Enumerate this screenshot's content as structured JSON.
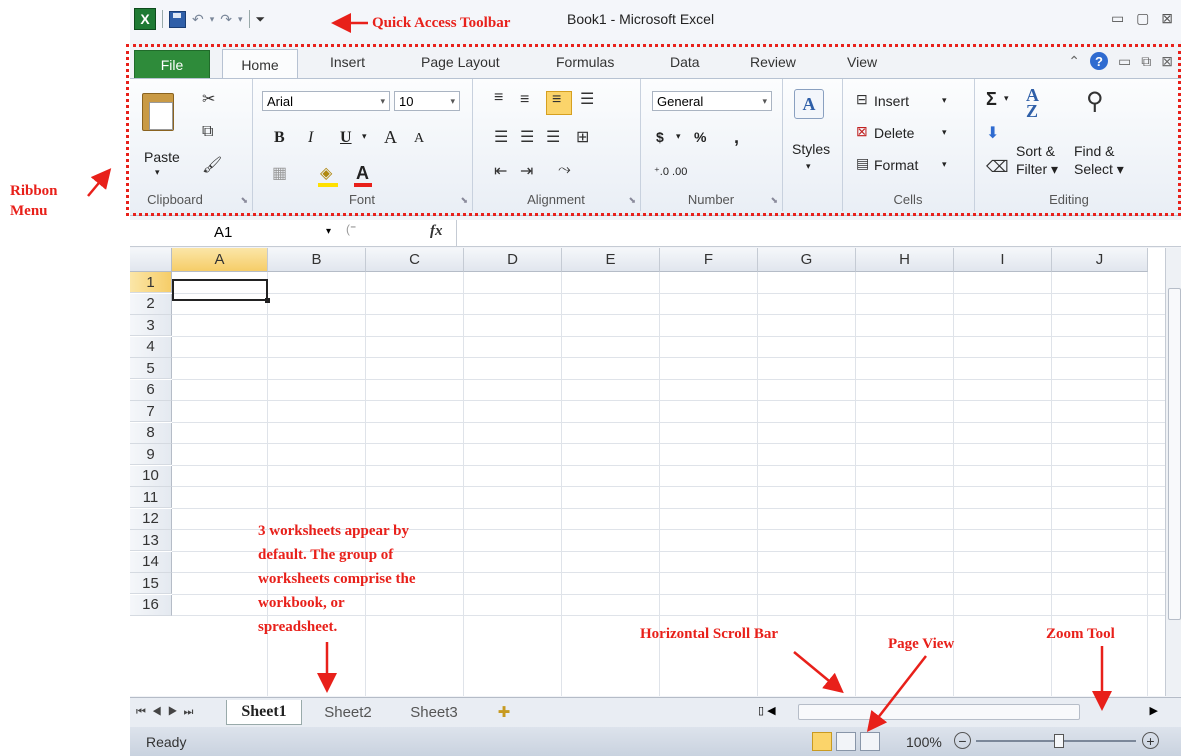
{
  "window": {
    "title": "Book1  -  Microsoft Excel",
    "logo": "X",
    "controls": "▭ ▢ ⊠"
  },
  "qat": {
    "undo": "↶",
    "redo": "↷",
    "customize": "⏷"
  },
  "tabs": [
    {
      "label": "File"
    },
    {
      "label": "Home"
    },
    {
      "label": "Insert"
    },
    {
      "label": "Page Layout"
    },
    {
      "label": "Formulas"
    },
    {
      "label": "Data"
    },
    {
      "label": "Review"
    },
    {
      "label": "View"
    }
  ],
  "ribbon": {
    "clipboard": {
      "label": "Clipboard",
      "paste": "Paste"
    },
    "font": {
      "label": "Font",
      "name": "Arial",
      "size": "10",
      "bold": "B",
      "italic": "I",
      "underline": "U",
      "grow": "A",
      "shrink": "A",
      "color": "A"
    },
    "alignment": {
      "label": "Alignment"
    },
    "number": {
      "label": "Number",
      "format": "General",
      "currency": "$",
      "percent": "%",
      "comma": ",",
      "inc": "⁺.0 .00",
      "dec": ".00 ⁺.0"
    },
    "styles": {
      "label": "Styles",
      "icon": "A"
    },
    "cells": {
      "label": "Cells",
      "insert": "Insert",
      "delete": "Delete",
      "format": "Format"
    },
    "editing": {
      "label": "Editing",
      "sum": "Σ",
      "sort": "Sort &",
      "filter": "Filter",
      "find": "Find &",
      "select": "Select"
    }
  },
  "formula_bar": {
    "name_box": "A1",
    "fx": "fx",
    "value": ""
  },
  "columns": [
    "A",
    "B",
    "C",
    "D",
    "E",
    "F",
    "G",
    "H",
    "I",
    "J"
  ],
  "rows": [
    "1",
    "2",
    "3",
    "4",
    "5",
    "6",
    "7",
    "8",
    "9",
    "10",
    "11",
    "12",
    "13",
    "14",
    "15",
    "16"
  ],
  "sheets": [
    {
      "label": "Sheet1",
      "active": true
    },
    {
      "label": "Sheet2",
      "active": false
    },
    {
      "label": "Sheet3",
      "active": false
    }
  ],
  "status": {
    "text": "Ready",
    "zoom": "100%"
  },
  "annotations": {
    "qat": "Quick Access Toolbar",
    "ribbon_line1": "Ribbon",
    "ribbon_line2": "Menu",
    "worksheets_1": "3 worksheets appear by",
    "worksheets_2": "default. The group of",
    "worksheets_3": "worksheets comprise the",
    "worksheets_4": "workbook, or",
    "worksheets_5": "spreadsheet.",
    "hscroll": "Horizontal Scroll Bar",
    "pageview": "Page View",
    "zoom": "Zoom Tool"
  },
  "colors": {
    "annotation": "#e8201a",
    "file_tab": "#2e8b3a",
    "active_header": "#f6cd68"
  }
}
